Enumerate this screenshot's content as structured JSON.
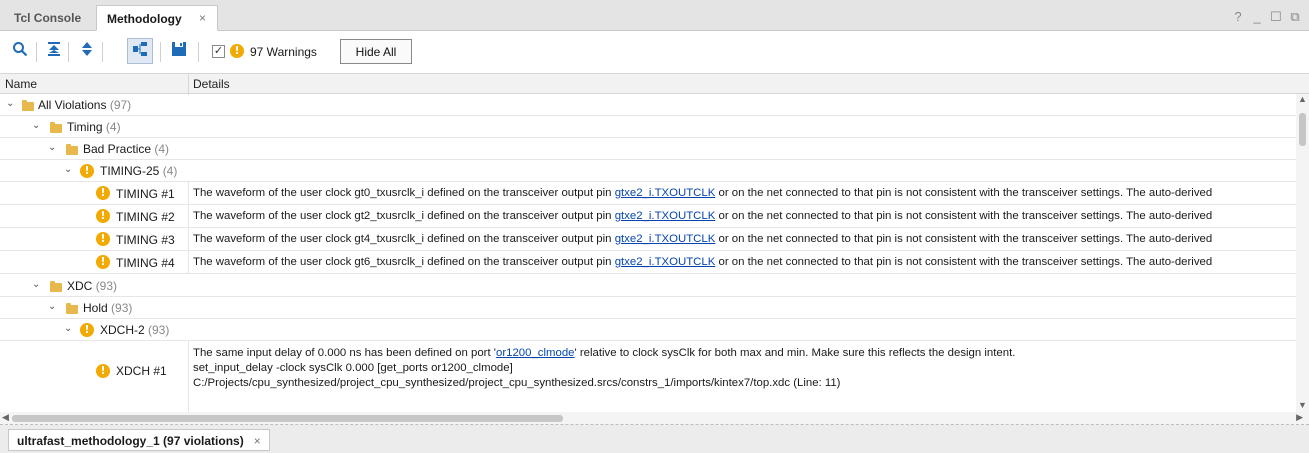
{
  "tabs": [
    {
      "label": "Tcl Console"
    },
    {
      "label": "Methodology",
      "close": "×"
    }
  ],
  "window_controls": {
    "help": "?",
    "minimize": "_",
    "restore": "☐",
    "float": "⧉"
  },
  "toolbar": {
    "icons": [
      "search-icon",
      "collapse-all-icon",
      "expand-all-icon",
      "group-by-icon",
      "save-icon"
    ],
    "warnings_checked": "✓",
    "warnings_icon": "!",
    "warnings_label": "97 Warnings",
    "hide_all_label": "Hide All"
  },
  "columns": {
    "name": "Name",
    "details": "Details"
  },
  "rows": {
    "all": {
      "label": "All Violations",
      "count": "(97)"
    },
    "timing": {
      "label": "Timing",
      "count": "(4)"
    },
    "bad_practice": {
      "label": "Bad Practice",
      "count": "(4)"
    },
    "timing25": {
      "label": "TIMING-25",
      "count": "(4)"
    },
    "t1": {
      "label": "TIMING #1",
      "pre": "The waveform of the user clock gt0_txusrclk_i defined on the transceiver output pin ",
      "link": "gtxe2_i.TXOUTCLK",
      "post": " or on the net connected to that pin is not consistent with the transceiver settings. The auto-derived"
    },
    "t2": {
      "label": "TIMING #2",
      "pre": "The waveform of the user clock gt2_txusrclk_i defined on the transceiver output pin ",
      "link": "gtxe2_i.TXOUTCLK",
      "post": " or on the net connected to that pin is not consistent with the transceiver settings. The auto-derived"
    },
    "t3": {
      "label": "TIMING #3",
      "pre": "The waveform of the user clock gt4_txusrclk_i defined on the transceiver output pin ",
      "link": "gtxe2_i.TXOUTCLK",
      "post": " or on the net connected to that pin is not consistent with the transceiver settings. The auto-derived"
    },
    "t4": {
      "label": "TIMING #4",
      "pre": "The waveform of the user clock gt6_txusrclk_i defined on the transceiver output pin ",
      "link": "gtxe2_i.TXOUTCLK",
      "post": " or on the net connected to that pin is not consistent with the transceiver settings. The auto-derived"
    },
    "xdc": {
      "label": "XDC",
      "count": "(93)"
    },
    "hold": {
      "label": "Hold",
      "count": "(93)"
    },
    "xdch2": {
      "label": "XDCH-2",
      "count": "(93)"
    },
    "xdch1": {
      "label": "XDCH #1",
      "line1_pre": "The same input delay of 0.000 ns has been defined on port '",
      "line1_link": "or1200_clmode",
      "line1_post": "' relative to clock sysClk for both max and min. Make sure this reflects the design intent.",
      "line2": "set_input_delay -clock sysClk 0.000 [get_ports or1200_clmode]",
      "line3": "C:/Projects/cpu_synthesized/project_cpu_synthesized/project_cpu_synthesized.srcs/constrs_1/imports/kintex7/top.xdc (Line: 11)"
    }
  },
  "bottom_tab": {
    "label": "ultrafast_methodology_1 (97 violations)",
    "close": "×"
  },
  "colors": {
    "warning": "#f2a900",
    "folder": "#e7b94c",
    "link": "#0645ad",
    "toolbar_icon": "#1e6bb8"
  }
}
